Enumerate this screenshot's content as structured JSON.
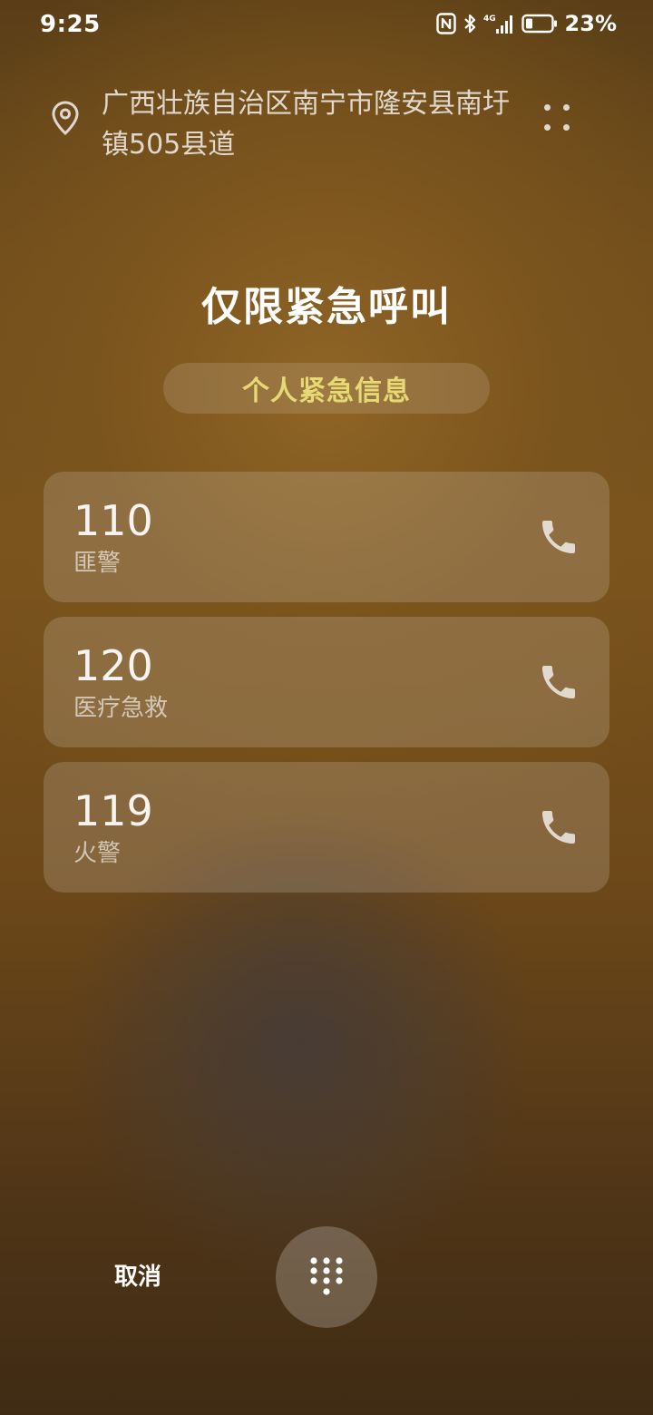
{
  "status_bar": {
    "time": "9:25",
    "network": "4G",
    "battery": "23%",
    "icons": [
      "nfc-icon",
      "bluetooth-icon",
      "signal-icon",
      "battery-icon"
    ]
  },
  "location": {
    "text": "广西壮族自治区南宁市隆安县南圩镇505县道",
    "icon": "location-pin-icon"
  },
  "title": "仅限紧急呼叫",
  "info_button": "个人紧急信息",
  "contacts": [
    {
      "number": "110",
      "label": "匪警"
    },
    {
      "number": "120",
      "label": "医疗急救"
    },
    {
      "number": "119",
      "label": "火警"
    }
  ],
  "bottom": {
    "cancel_label": "取消",
    "dialpad_icon": "dialpad-icon"
  },
  "colors": {
    "accent": "#e6d873",
    "card_bg": "rgba(255,255,255,0.16)"
  }
}
